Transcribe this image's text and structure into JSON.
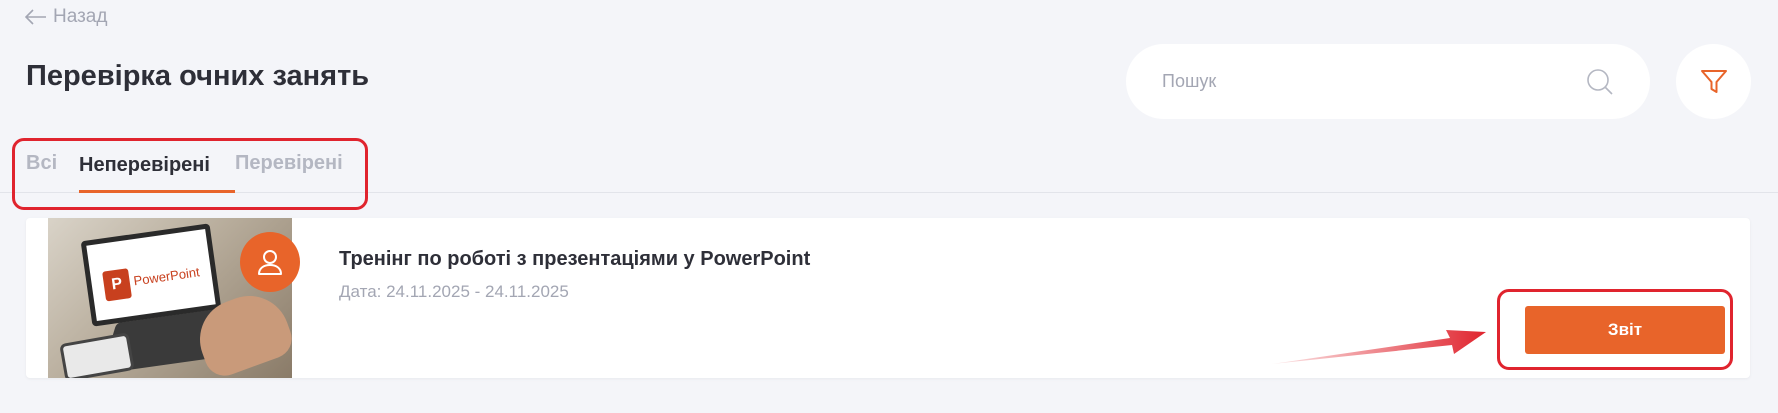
{
  "nav": {
    "back_label": "Назад"
  },
  "header": {
    "title": "Перевірка очних занять"
  },
  "search": {
    "placeholder": "Пошук"
  },
  "tabs": [
    {
      "label": "Всі",
      "active": false
    },
    {
      "label": "Неперевірені",
      "active": true
    },
    {
      "label": "Перевірені",
      "active": false
    }
  ],
  "course": {
    "thumbnail_text": "PowerPoint",
    "title": "Тренінг по роботі з презентаціями у PowerPoint",
    "date": "Дата: 24.11.2025 - 24.11.2025",
    "report_label": "Звіт"
  },
  "icons": {
    "back": "arrow-left-icon",
    "search": "search-icon",
    "filter": "filter-icon",
    "avatar": "user-icon"
  },
  "colors": {
    "accent": "#e8642a",
    "annotation": "#e0242e",
    "background": "#f4f5f9",
    "text_primary": "#2e2f38",
    "text_muted": "#a3a6b3"
  }
}
